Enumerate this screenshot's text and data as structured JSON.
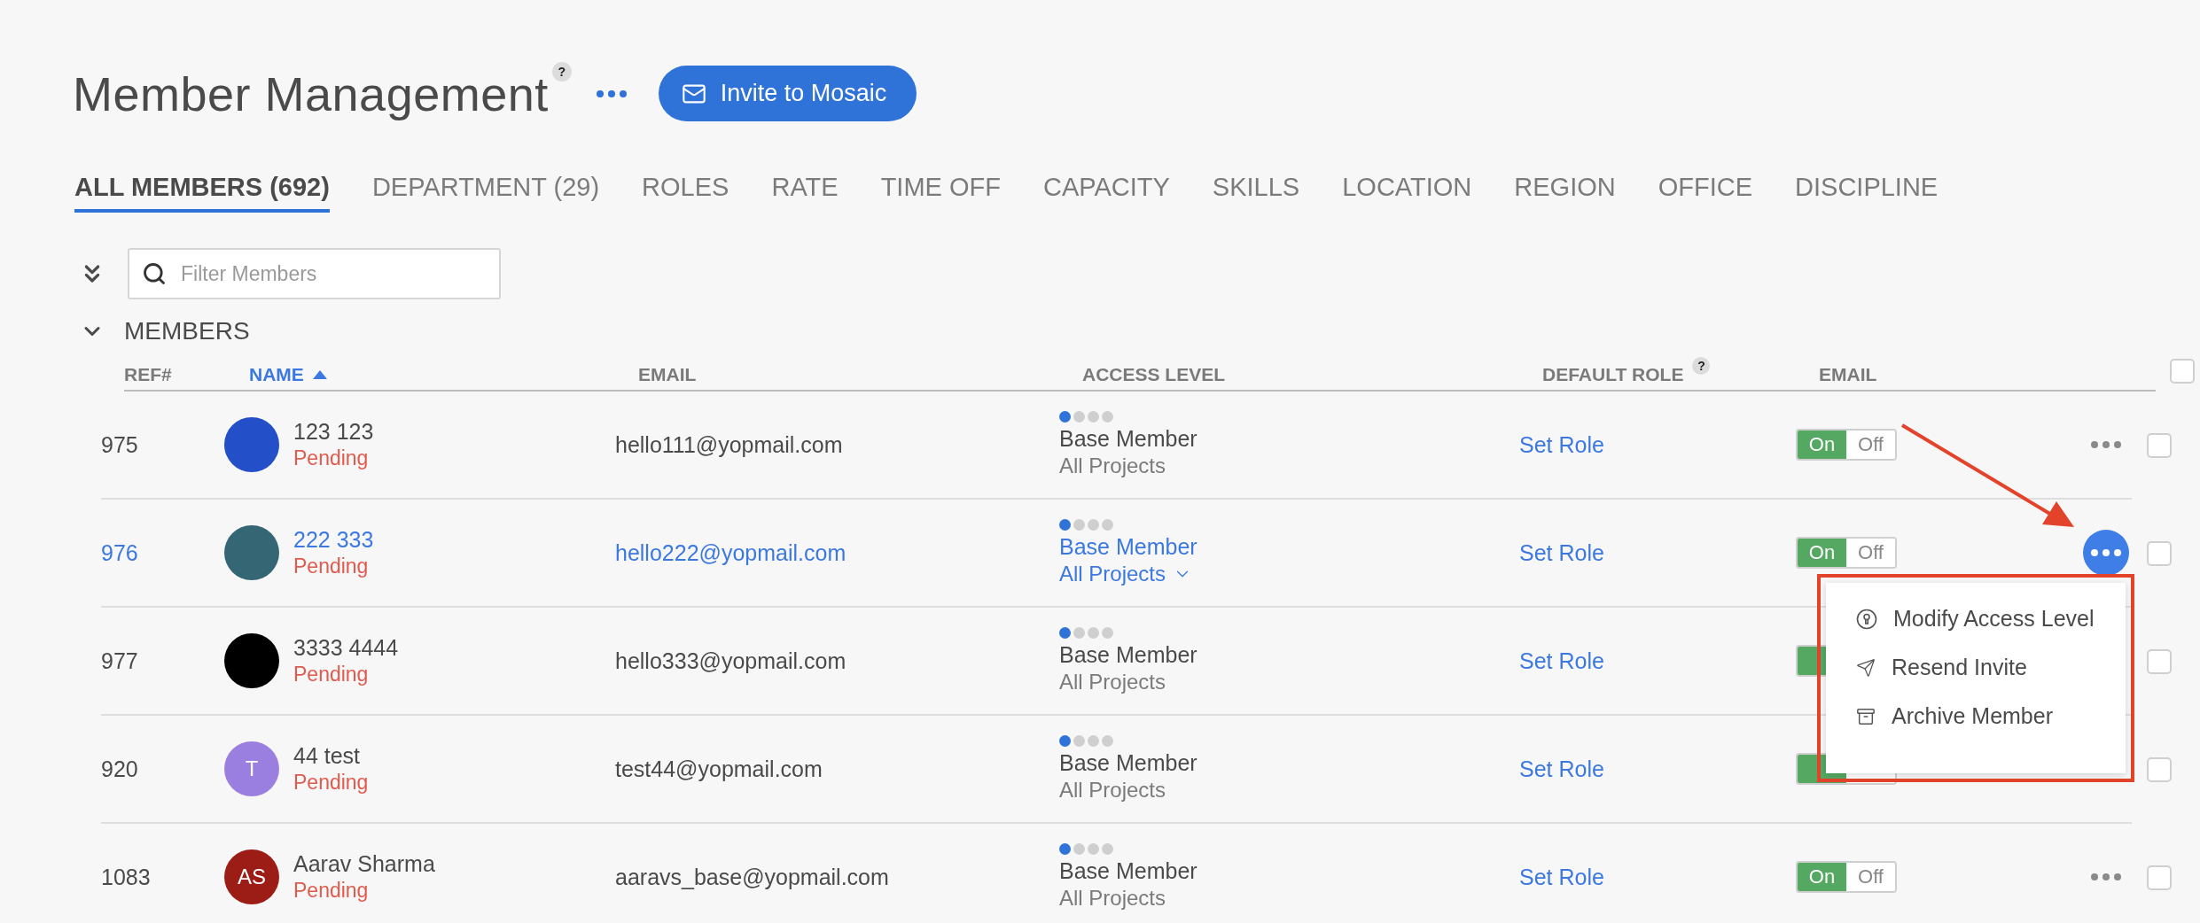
{
  "page": {
    "title": "Member Management",
    "help": "?"
  },
  "invite_button": {
    "label": "Invite to Mosaic"
  },
  "tabs": [
    {
      "label": "ALL MEMBERS (692)",
      "selected": true
    },
    {
      "label": "DEPARTMENT (29)",
      "selected": false
    },
    {
      "label": "ROLES",
      "selected": false
    },
    {
      "label": "RATE",
      "selected": false
    },
    {
      "label": "TIME OFF",
      "selected": false
    },
    {
      "label": "CAPACITY",
      "selected": false
    },
    {
      "label": "SKILLS",
      "selected": false
    },
    {
      "label": "LOCATION",
      "selected": false
    },
    {
      "label": "REGION",
      "selected": false
    },
    {
      "label": "OFFICE",
      "selected": false
    },
    {
      "label": "DISCIPLINE",
      "selected": false
    }
  ],
  "filter": {
    "placeholder": "Filter Members"
  },
  "section": {
    "title": "MEMBERS",
    "expanded": true
  },
  "columns": [
    {
      "label": "REF#",
      "sorted": false
    },
    {
      "label": "NAME",
      "sorted": true
    },
    {
      "label": "EMAIL",
      "sorted": false
    },
    {
      "label": "ACCESS LEVEL",
      "sorted": false
    },
    {
      "label": "DEFAULT ROLE",
      "sorted": false,
      "help": "?"
    },
    {
      "label": "EMAIL",
      "sorted": false
    }
  ],
  "select_all": {
    "checked": false
  },
  "rows": [
    {
      "ref": "975",
      "name": "123 123",
      "status": "Pending",
      "avatar": {
        "color": "#2350c8"
      },
      "email": "hello111@yopmail.com",
      "access": {
        "level": 0.25,
        "role": "Base Member",
        "scope": "All Projects"
      },
      "default_role": "Set Role",
      "email_toggle": {
        "on": true,
        "on_label": "On",
        "off_label": "Off"
      },
      "highlighted": false,
      "checked": false
    },
    {
      "ref": "976",
      "name": "222 333",
      "status": "Pending",
      "avatar": {
        "color": "#356674"
      },
      "email": "hello222@yopmail.com",
      "access": {
        "level": 0.25,
        "role": "Base Member",
        "scope": "All Projects"
      },
      "default_role": "Set Role",
      "email_toggle": {
        "on": true,
        "on_label": "On",
        "off_label": "Off"
      },
      "highlighted": true,
      "checked": false
    },
    {
      "ref": "977",
      "name": "3333 4444",
      "status": "Pending",
      "avatar": {
        "color": "#000000"
      },
      "email": "hello333@yopmail.com",
      "access": {
        "level": 0.25,
        "role": "Base Member",
        "scope": "All Projects"
      },
      "default_role": "Set Role",
      "email_toggle": {
        "on": true
      },
      "highlighted": false,
      "checked": false
    },
    {
      "ref": "920",
      "name": "44 test",
      "status": "Pending",
      "avatar": {
        "color": "#9b7fe0",
        "initials": "T"
      },
      "email": "test44@yopmail.com",
      "access": {
        "level": 0.25,
        "role": "Base Member",
        "scope": "All Projects"
      },
      "default_role": "Set Role",
      "email_toggle": {
        "on": true
      },
      "highlighted": false,
      "checked": false
    },
    {
      "ref": "1083",
      "name": "Aarav Sharma",
      "status": "Pending",
      "avatar": {
        "color": "#9c1c16",
        "initials": "AS"
      },
      "email": "aaravs_base@yopmail.com",
      "access": {
        "level": 0.25,
        "role": "Base Member",
        "scope": "All Projects"
      },
      "default_role": "Set Role",
      "email_toggle": {
        "on": true,
        "on_label": "On",
        "off_label": "Off"
      },
      "highlighted": false,
      "checked": false
    }
  ],
  "row_menu": {
    "items": [
      {
        "kind": "access",
        "label": "Modify Access Level"
      },
      {
        "kind": "send",
        "label": "Resend Invite"
      },
      {
        "kind": "archive",
        "label": "Archive Member"
      }
    ]
  }
}
